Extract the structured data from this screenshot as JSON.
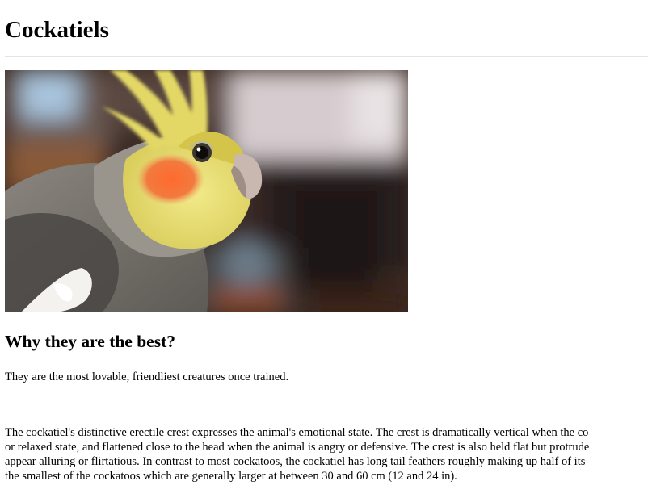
{
  "page": {
    "title": "Cockatiels",
    "subtitle": "Why they are the best?",
    "intro": "They are the most lovable, friendliest creatures once trained.",
    "body_lines": [
      "The cockatiel's distinctive erectile crest expresses the animal's emotional state. The crest is dramatically vertical when the co",
      "or relaxed state, and flattened close to the head when the animal is angry or defensive. The crest is also held flat but protrude",
      "appear alluring or flirtatious. In contrast to most cockatoos, the cockatiel has long tail feathers roughly making up half of its",
      "the smallest of the cockatoos which are generally larger at between 30 and 60 cm (12 and 24 in)."
    ]
  },
  "image": {
    "subject": "cockatiel-photo",
    "colors": {
      "crest": "#e8dc6a",
      "cheek": "#f06a3a",
      "face": "#ece27a",
      "body": "#7d7872",
      "background_dark": "#2e2420",
      "background_light": "#d9cfd2"
    }
  }
}
